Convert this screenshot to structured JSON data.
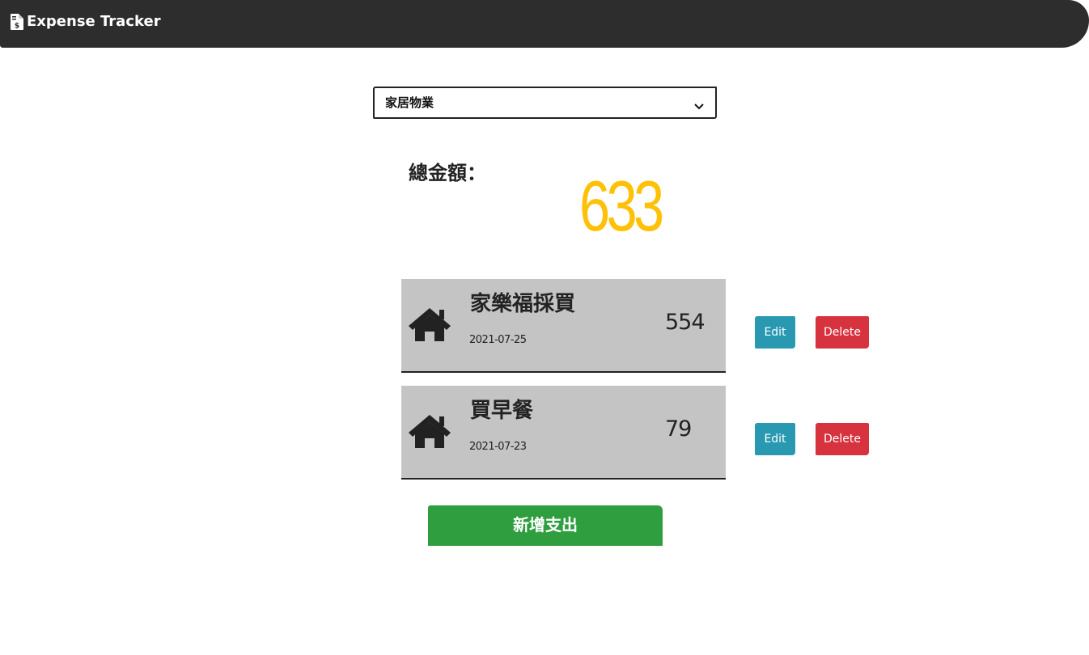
{
  "header": {
    "title": "Expense Tracker",
    "icon": "file-invoice-dollar-icon",
    "background": "#2d2d2d"
  },
  "filter": {
    "selected": "家居物業"
  },
  "total": {
    "label": "總金額：",
    "amount": "633",
    "color": "#ffc107"
  },
  "records": [
    {
      "name": "家樂福採買",
      "date": "2021-07-25",
      "amount": "554",
      "icon": "home-icon",
      "edit_label": "Edit",
      "delete_label": "Delete"
    },
    {
      "name": "買早餐",
      "date": "2021-07-23",
      "amount": "79",
      "icon": "home-icon",
      "edit_label": "Edit",
      "delete_label": "Delete"
    }
  ],
  "actions": {
    "add_label": "新增支出"
  },
  "colors": {
    "edit": "#2899b1",
    "delete": "#d7333f",
    "add": "#2e9e3e",
    "record_bg": "#c4c4c4"
  }
}
